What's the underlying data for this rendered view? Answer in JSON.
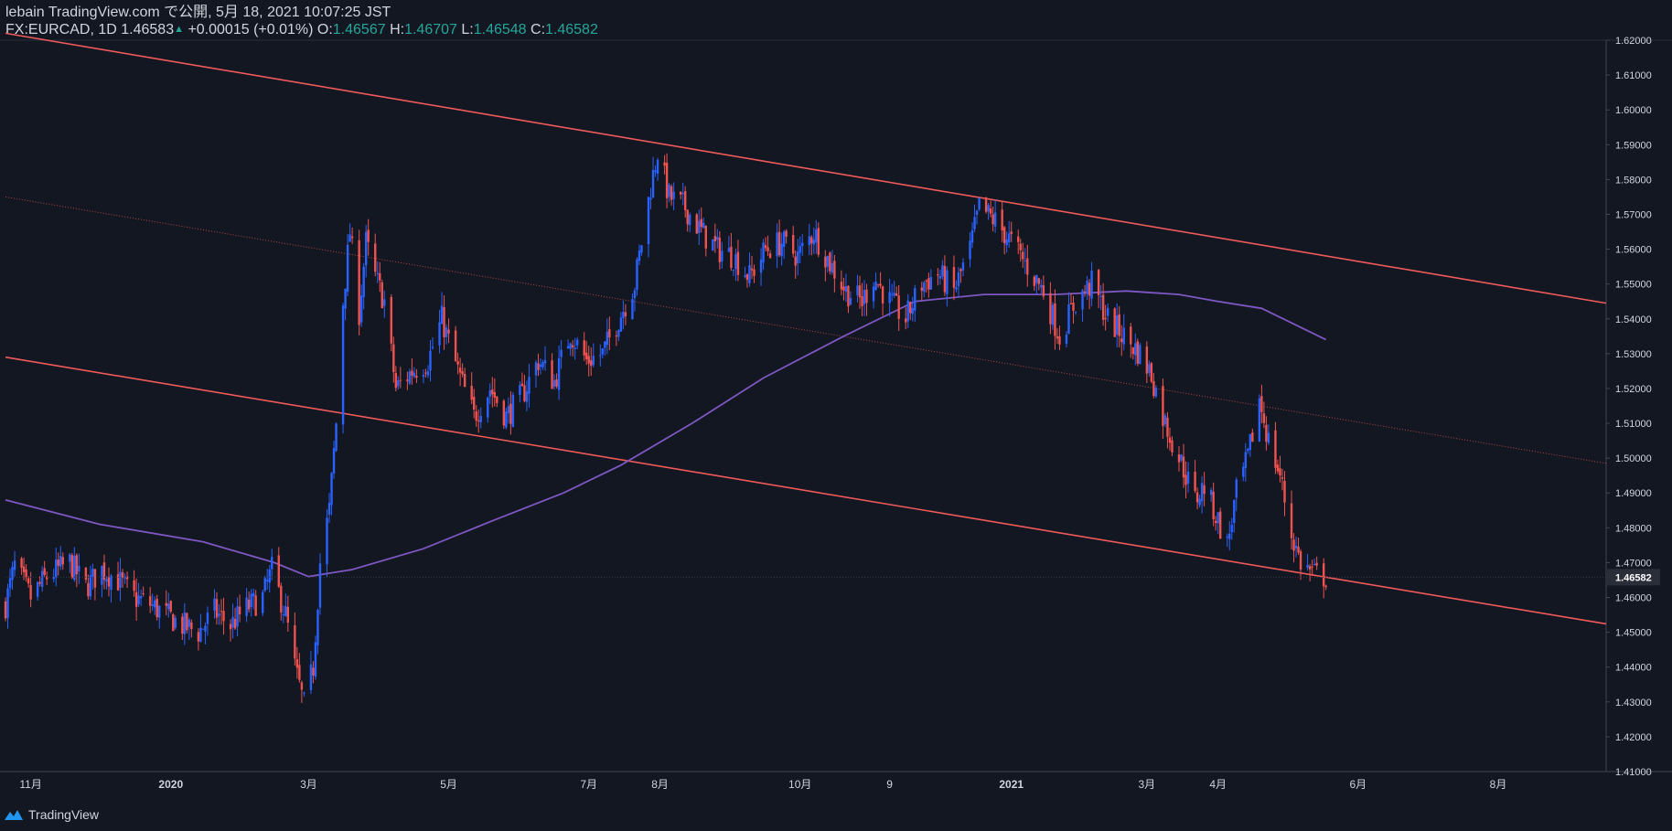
{
  "header": {
    "line1": "lebain TradingView.com で公開, 5月 18, 2021 10:07:25 JST",
    "symbol": "FX:EURCAD, 1D",
    "last": "1.46583",
    "change": "+0.00015 (+0.01%)",
    "o_label": "O:",
    "o_value": "1.46567",
    "h_label": "H:",
    "h_value": "1.46707",
    "l_label": "L:",
    "l_value": "1.46548",
    "c_label": "C:",
    "c_value": "1.46582"
  },
  "footer": {
    "brand": "TradingView"
  },
  "colors": {
    "background": "#131722",
    "up_candle": "#2962ff",
    "down_candle": "#ef5350",
    "channel": "#f05a5a",
    "moving_average": "#7e57c2",
    "axis_text": "#d1d4dc",
    "price_tag_bg": "#2a2e39"
  },
  "chart_data": {
    "type": "candlestick",
    "instrument": "FX:EURCAD",
    "interval": "1D",
    "y_range": [
      1.41,
      1.62
    ],
    "price_ticks": [
      "1.41000",
      "1.42000",
      "1.43000",
      "1.44000",
      "1.45000",
      "1.46000",
      "1.47000",
      "1.48000",
      "1.49000",
      "1.50000",
      "1.51000",
      "1.52000",
      "1.53000",
      "1.54000",
      "1.55000",
      "1.56000",
      "1.57000",
      "1.58000",
      "1.59000",
      "1.60000",
      "1.61000",
      "1.62000"
    ],
    "current_price_label": "1.46582",
    "time_labels": [
      {
        "label": "11月",
        "date": "2019-11-01"
      },
      {
        "label": "2020",
        "date": "2020-01-01"
      },
      {
        "label": "3月",
        "date": "2020-03-01"
      },
      {
        "label": "5月",
        "date": "2020-05-01"
      },
      {
        "label": "7月",
        "date": "2020-07-01"
      },
      {
        "label": "8月",
        "date": "2020-08-01"
      },
      {
        "label": "10月",
        "date": "2020-10-01"
      },
      {
        "label": "9",
        "date": "2020-11-09"
      },
      {
        "label": "2021",
        "date": "2021-01-01"
      },
      {
        "label": "3月",
        "date": "2021-03-01"
      },
      {
        "label": "4月",
        "date": "2021-04-01"
      },
      {
        "label": "6月",
        "date": "2021-06-01"
      },
      {
        "label": "8月",
        "date": "2021-08-01"
      }
    ],
    "close_path": [
      [
        "2019-10-21",
        1.458
      ],
      [
        "2019-10-25",
        1.469
      ],
      [
        "2019-11-01",
        1.46
      ],
      [
        "2019-11-08",
        1.466
      ],
      [
        "2019-11-18",
        1.47
      ],
      [
        "2019-11-25",
        1.463
      ],
      [
        "2019-12-02",
        1.468
      ],
      [
        "2019-12-09",
        1.465
      ],
      [
        "2019-12-16",
        1.46
      ],
      [
        "2019-12-23",
        1.458
      ],
      [
        "2020-01-06",
        1.452
      ],
      [
        "2020-01-13",
        1.45
      ],
      [
        "2020-01-20",
        1.456
      ],
      [
        "2020-01-27",
        1.452
      ],
      [
        "2020-02-03",
        1.457
      ],
      [
        "2020-02-10",
        1.46
      ],
      [
        "2020-02-14",
        1.468
      ],
      [
        "2020-02-20",
        1.455
      ],
      [
        "2020-02-24",
        1.44
      ],
      [
        "2020-02-28",
        1.429
      ],
      [
        "2020-03-03",
        1.44
      ],
      [
        "2020-03-06",
        1.47
      ],
      [
        "2020-03-10",
        1.485
      ],
      [
        "2020-03-13",
        1.51
      ],
      [
        "2020-03-16",
        1.545
      ],
      [
        "2020-03-19",
        1.565
      ],
      [
        "2020-03-23",
        1.542
      ],
      [
        "2020-03-26",
        1.562
      ],
      [
        "2020-03-30",
        1.552
      ],
      [
        "2020-04-03",
        1.545
      ],
      [
        "2020-04-08",
        1.52
      ],
      [
        "2020-04-15",
        1.525
      ],
      [
        "2020-04-22",
        1.528
      ],
      [
        "2020-04-28",
        1.54
      ],
      [
        "2020-05-05",
        1.525
      ],
      [
        "2020-05-12",
        1.512
      ],
      [
        "2020-05-19",
        1.52
      ],
      [
        "2020-05-26",
        1.512
      ],
      [
        "2020-06-02",
        1.518
      ],
      [
        "2020-06-09",
        1.528
      ],
      [
        "2020-06-16",
        1.522
      ],
      [
        "2020-06-23",
        1.536
      ],
      [
        "2020-06-30",
        1.528
      ],
      [
        "2020-07-07",
        1.53
      ],
      [
        "2020-07-14",
        1.54
      ],
      [
        "2020-07-21",
        1.55
      ],
      [
        "2020-07-28",
        1.578
      ],
      [
        "2020-07-31",
        1.588
      ],
      [
        "2020-08-05",
        1.575
      ],
      [
        "2020-08-12",
        1.572
      ],
      [
        "2020-08-19",
        1.565
      ],
      [
        "2020-08-26",
        1.56
      ],
      [
        "2020-09-02",
        1.558
      ],
      [
        "2020-09-09",
        1.552
      ],
      [
        "2020-09-16",
        1.56
      ],
      [
        "2020-09-23",
        1.562
      ],
      [
        "2020-09-30",
        1.558
      ],
      [
        "2020-10-07",
        1.565
      ],
      [
        "2020-10-14",
        1.556
      ],
      [
        "2020-10-21",
        1.548
      ],
      [
        "2020-10-28",
        1.545
      ],
      [
        "2020-11-02",
        1.552
      ],
      [
        "2020-11-09",
        1.545
      ],
      [
        "2020-11-16",
        1.54
      ],
      [
        "2020-11-23",
        1.55
      ],
      [
        "2020-11-30",
        1.553
      ],
      [
        "2020-12-07",
        1.548
      ],
      [
        "2020-12-14",
        1.56
      ],
      [
        "2020-12-18",
        1.572
      ],
      [
        "2020-12-25",
        1.568
      ],
      [
        "2021-01-01",
        1.562
      ],
      [
        "2021-01-08",
        1.555
      ],
      [
        "2021-01-15",
        1.548
      ],
      [
        "2021-01-22",
        1.535
      ],
      [
        "2021-01-29",
        1.545
      ],
      [
        "2021-02-05",
        1.55
      ],
      [
        "2021-02-12",
        1.54
      ],
      [
        "2021-02-19",
        1.535
      ],
      [
        "2021-02-26",
        1.53
      ],
      [
        "2021-03-03",
        1.524
      ],
      [
        "2021-03-08",
        1.512
      ],
      [
        "2021-03-12",
        1.505
      ],
      [
        "2021-03-17",
        1.497
      ],
      [
        "2021-03-22",
        1.488
      ],
      [
        "2021-03-26",
        1.492
      ],
      [
        "2021-04-01",
        1.482
      ],
      [
        "2021-04-05",
        1.475
      ],
      [
        "2021-04-09",
        1.49
      ],
      [
        "2021-04-14",
        1.5
      ],
      [
        "2021-04-19",
        1.517
      ],
      [
        "2021-04-23",
        1.505
      ],
      [
        "2021-04-28",
        1.495
      ],
      [
        "2021-05-03",
        1.478
      ],
      [
        "2021-05-07",
        1.47
      ],
      [
        "2021-05-12",
        1.467
      ],
      [
        "2021-05-18",
        1.4658
      ]
    ],
    "moving_average": [
      [
        "2019-10-21",
        1.488
      ],
      [
        "2019-12-01",
        1.481
      ],
      [
        "2020-01-15",
        1.476
      ],
      [
        "2020-02-15",
        1.47
      ],
      [
        "2020-03-01",
        1.466
      ],
      [
        "2020-03-20",
        1.468
      ],
      [
        "2020-04-20",
        1.474
      ],
      [
        "2020-05-20",
        1.482
      ],
      [
        "2020-06-20",
        1.49
      ],
      [
        "2020-07-15",
        1.498
      ],
      [
        "2020-08-15",
        1.51
      ],
      [
        "2020-09-15",
        1.523
      ],
      [
        "2020-10-20",
        1.535
      ],
      [
        "2020-11-20",
        1.545
      ],
      [
        "2020-12-20",
        1.547
      ],
      [
        "2021-01-20",
        1.547
      ],
      [
        "2021-02-20",
        1.548
      ],
      [
        "2021-03-15",
        1.547
      ],
      [
        "2021-04-01",
        1.545
      ],
      [
        "2021-04-20",
        1.543
      ],
      [
        "2021-05-18",
        1.534
      ]
    ],
    "channel_lines": [
      {
        "name": "upper",
        "style": "solid",
        "from": [
          "2019-10-21",
          1.622
        ],
        "to": [
          "2021-09-17",
          1.5445
        ]
      },
      {
        "name": "middle",
        "style": "dotted",
        "from": [
          "2019-10-21",
          1.575
        ],
        "to": [
          "2021-09-17",
          1.4985
        ]
      },
      {
        "name": "lower",
        "style": "solid",
        "from": [
          "2019-10-21",
          1.529
        ],
        "to": [
          "2021-09-17",
          1.4524
        ]
      }
    ]
  }
}
